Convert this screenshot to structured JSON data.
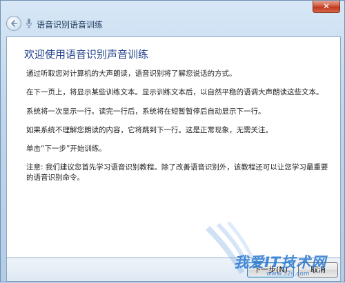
{
  "window": {
    "title": "语音识别语音训练",
    "close_glyph": "✕"
  },
  "content": {
    "heading": "欢迎使用语音识别声音训练",
    "paragraphs": [
      "通过听取您对计算机的大声朗读，语音识别将了解您说话的方式。",
      "在下一页上，将显示某些训练文本。显示训练文本后，以自然平稳的语调大声朗读这些文本。",
      "系统将一次显示一行。读完一行后，系统将在短暂暂停后自动显示下一行。",
      "如果系统不理解您朗读的内容，它将跳到下一行。这是正常现象，无需关注。",
      "单击“下一步”开始训练。",
      "注意: 我们建议您首先学习语音识别教程。除了改善语音识别外，该教程还可以让您学习最重要的语音识别命令。"
    ]
  },
  "footer": {
    "next_label": "下一步(N)",
    "cancel_label": "取消"
  },
  "watermark": {
    "text": "我爱IT技术网",
    "url": "www.52ij.com"
  },
  "icons": {
    "back": "back-arrow-icon",
    "mic": "microphone-icon"
  }
}
